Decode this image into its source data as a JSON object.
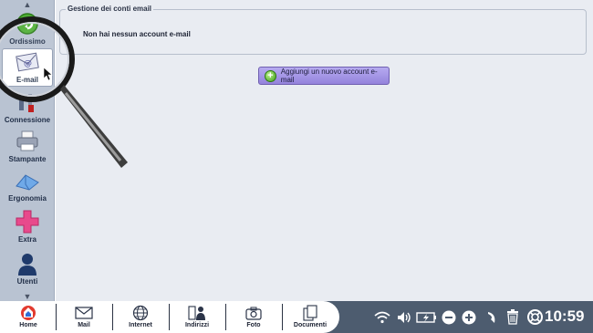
{
  "sidebar": {
    "items": [
      {
        "label": "Ordissimo",
        "icon": "ordissimo-icon"
      },
      {
        "label": "E-mail",
        "icon": "email-icon",
        "active": true
      },
      {
        "label": "Connessione",
        "icon": "tools-icon"
      },
      {
        "label": "Stampante",
        "icon": "printer-icon"
      },
      {
        "label": "Ergonomia",
        "icon": "ergonomics-icon"
      },
      {
        "label": "Extra",
        "icon": "plus-icon"
      },
      {
        "label": "Utenti",
        "icon": "user-icon"
      }
    ]
  },
  "main": {
    "group_title": "Gestione dei conti email",
    "no_account_message": "Non hai nessun account e-mail",
    "add_account_button": "Aggiungi un nuovo account e-mail"
  },
  "taskbar": {
    "items": [
      {
        "label": "Home",
        "icon": "home-icon"
      },
      {
        "label": "Mail",
        "icon": "mail-icon"
      },
      {
        "label": "Internet",
        "icon": "globe-icon"
      },
      {
        "label": "Indirizzi",
        "icon": "contacts-icon"
      },
      {
        "label": "Foto",
        "icon": "camera-icon"
      },
      {
        "label": "Documenti",
        "icon": "documents-icon"
      }
    ],
    "tray_icons": [
      "wifi-icon",
      "volume-icon",
      "battery-icon",
      "zoom-out-icon",
      "zoom-in-icon",
      "undo-icon",
      "trash-icon",
      "help-icon"
    ],
    "clock": "10:59"
  },
  "colors": {
    "sidebar_bg": "#b9c3d2",
    "main_bg": "#e9ecf2",
    "taskbar_bg": "#4d5c6f",
    "button_bg": "#9f8fe4"
  }
}
